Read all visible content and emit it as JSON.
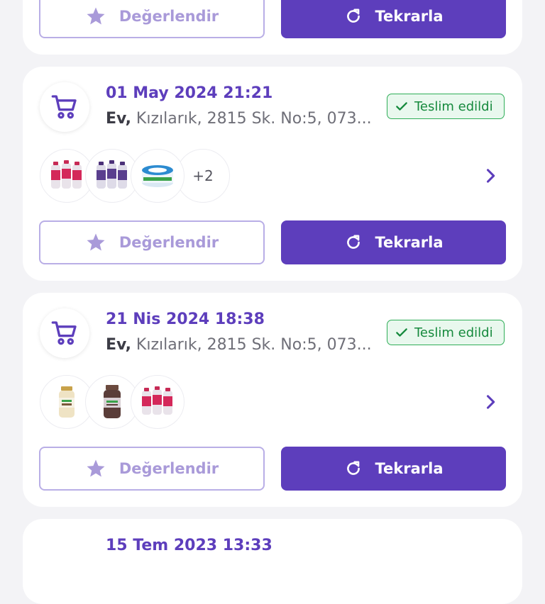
{
  "orders": [
    {
      "date": "",
      "address_type": "",
      "address": "",
      "status": "",
      "extra_count": "",
      "rate_label": "Değerlendir",
      "repeat_label": "Tekrarla"
    },
    {
      "date": "01 May 2024 21:21",
      "address_type": "Ev,",
      "address": " Kızılarık, 2815 Sk. No:5, 073...",
      "status": "Teslim edildi",
      "extra_count": "+2",
      "rate_label": "Değerlendir",
      "repeat_label": "Tekrarla",
      "products": [
        "kefir-bottles-pink",
        "kefir-bottles-purple",
        "cream-cheese-tub"
      ]
    },
    {
      "date": "21 Nis 2024 18:38",
      "address_type": "Ev,",
      "address": " Kızılarık, 2815 Sk. No:5, 073...",
      "status": "Teslim edildi",
      "extra_count": "",
      "rate_label": "Değerlendir",
      "repeat_label": "Tekrarla",
      "products": [
        "tahini-jar",
        "molasses-jar",
        "kefir-bottles-pink"
      ]
    },
    {
      "date": "15 Tem 2023 13:33",
      "address_type": "",
      "address": "",
      "status": "",
      "extra_count": "",
      "rate_label": "",
      "repeat_label": ""
    }
  ],
  "colors": {
    "brand_purple": "#5d3ebc",
    "rate_button_border": "#b9aee6",
    "rate_button_text": "#a99ad9",
    "delivered_green": "#168a3d",
    "page_background": "#f3f3f6"
  },
  "icons": {
    "cart": "shopping-cart-icon",
    "star": "star-icon",
    "repeat": "refresh-icon",
    "check": "check-icon",
    "chevron": "chevron-right-icon"
  }
}
